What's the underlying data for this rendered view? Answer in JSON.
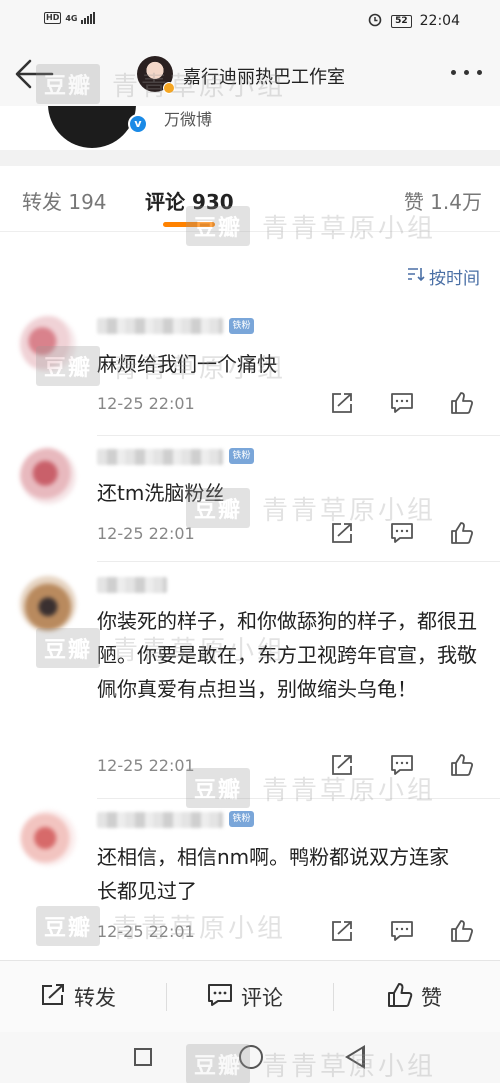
{
  "status_bar": {
    "left_badge": "HD",
    "network": "4G",
    "battery": "52",
    "time": "22:04"
  },
  "nav": {
    "title": "嘉行迪丽热巴工作室"
  },
  "post_header": {
    "source": "万微博"
  },
  "tabs": {
    "repost": "转发 194",
    "comment": "评论 930",
    "like": "赞 1.4万"
  },
  "sort": {
    "label": "按时间"
  },
  "comments": [
    {
      "badge": "铁粉",
      "text": "麻烦给我们一个痛快",
      "time": "12-25 22:01"
    },
    {
      "badge": "铁粉",
      "text": "还tm洗脑粉丝",
      "time": "12-25 22:01"
    },
    {
      "badge": "",
      "text": "你装死的样子，和你做舔狗的样子，都很丑陋。你要是敢在，东方卫视跨年官宣，我敬佩你真爱有点担当，别做缩头乌龟！",
      "time": "12-25 22:01"
    },
    {
      "badge": "铁粉",
      "text": "还相信，相信nm啊。鸭粉都说双方连家长都见过了",
      "time": "12-25 22:01"
    }
  ],
  "toolbar": {
    "repost": "转发",
    "comment": "评论",
    "like": "赞"
  },
  "watermark": {
    "logo": "豆瓣",
    "text": "青青草原小组"
  },
  "colors": {
    "accent": "#ff8200",
    "link": "#4a6fa5",
    "fan_badge": "#7aa6d9",
    "verified": "#1a8ae6"
  }
}
